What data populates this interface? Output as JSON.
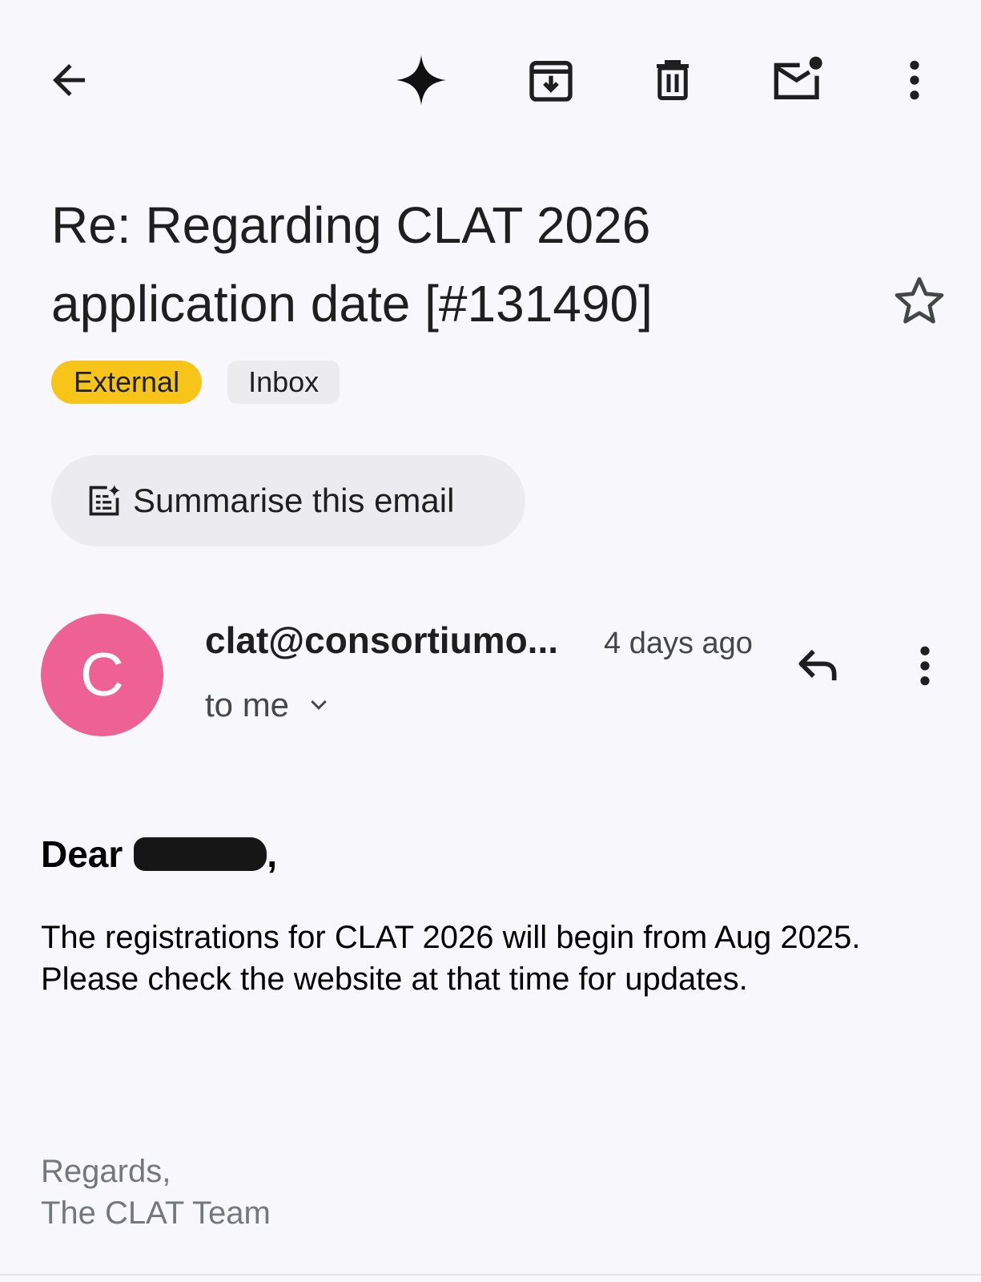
{
  "toolbar": {
    "icons": [
      "back-arrow-icon",
      "gemini-sparkle-icon",
      "archive-icon",
      "delete-icon",
      "mark-unread-icon",
      "more-vert-icon"
    ]
  },
  "email": {
    "subject": "Re: Regarding CLAT 2026 application date [#131490]",
    "labels": [
      "External",
      "Inbox"
    ],
    "summarise_label": "Summarise this email",
    "sender_initial": "C",
    "sender": "clat@consortiumo...",
    "time": "4 days ago",
    "recipient": "to me",
    "greeting": "Dear",
    "greeting_suffix": ",",
    "body_line1": "The registrations for CLAT 2026 will begin from Aug 2025.",
    "body_line2": "Please check the website at that time for updates.",
    "sign_line1": "Regards,",
    "sign_line2": "The CLAT Team"
  },
  "colors": {
    "background": "#f8f8fc",
    "external_label": "#f7c51a",
    "avatar": "#ee6293"
  }
}
